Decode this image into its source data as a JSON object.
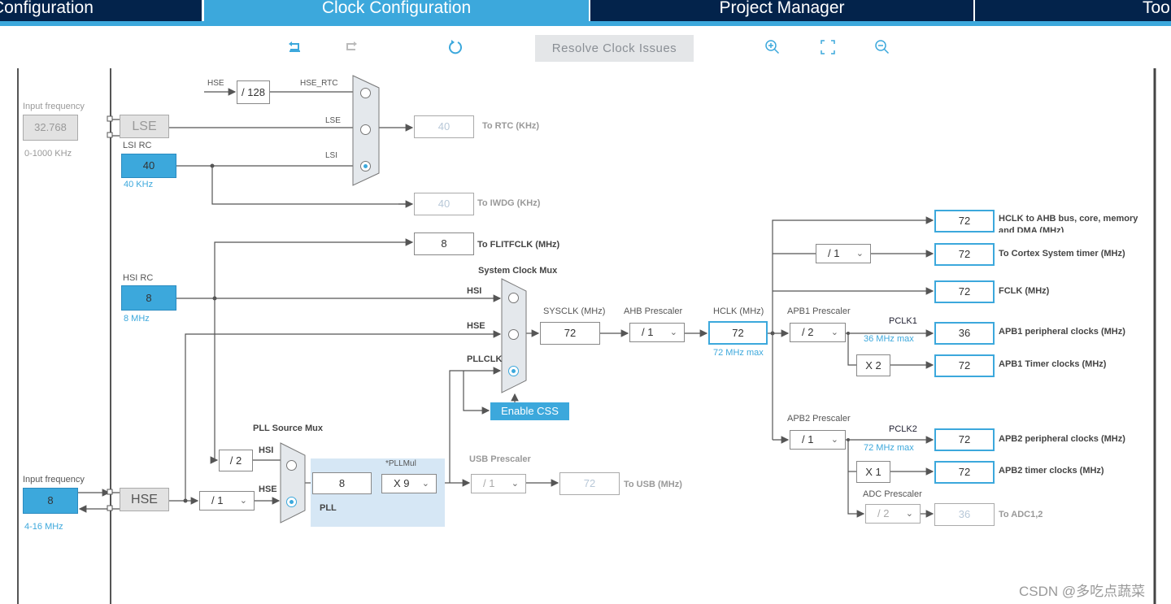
{
  "tabs": [
    {
      "label": "Configuration"
    },
    {
      "label": "Clock Configuration",
      "active": true
    },
    {
      "label": "Project Manager"
    },
    {
      "label": "Too"
    }
  ],
  "toolbar": {
    "undo_icon": "undo-icon",
    "redo_icon": "redo-icon",
    "refresh_icon": "refresh-icon",
    "resolve": "Resolve Clock Issues",
    "zoom_in_icon": "zoom-in-icon",
    "fit_icon": "fit-screen-icon",
    "zoom_out_icon": "zoom-out-icon"
  },
  "lse_in": {
    "label": "Input frequency",
    "value": "32.768",
    "range": "0-1000 KHz",
    "name": "LSE"
  },
  "lsi": {
    "label": "LSI RC",
    "value": "40",
    "unit": "40 KHz"
  },
  "hsi": {
    "label": "HSI RC",
    "value": "8",
    "unit": "8 MHz"
  },
  "hse_in": {
    "label": "Input frequency",
    "value": "8",
    "range": "4-16 MHz",
    "name": "HSE"
  },
  "rtc": {
    "hse": "HSE",
    "div": "/ 128",
    "hse_rtc": "HSE_RTC",
    "lse": "LSE",
    "lsi": "LSI",
    "out": "40",
    "out_label": "To RTC (KHz)"
  },
  "iwdg": {
    "out": "40",
    "label": "To IWDG (KHz)"
  },
  "flit": {
    "out": "8",
    "label": "To FLITFCLK (MHz)"
  },
  "sysmux": {
    "title": "System Clock Mux",
    "hsi": "HSI",
    "hse": "HSE",
    "pllclk": "PLLCLK",
    "css": "Enable CSS"
  },
  "sysclk": {
    "label": "SYSCLK (MHz)",
    "value": "72"
  },
  "ahb": {
    "label": "AHB Prescaler",
    "value": "/ 1"
  },
  "hclk": {
    "label": "HCLK (MHz)",
    "value": "72",
    "max": "72 MHz max"
  },
  "apb1": {
    "label": "APB1 Prescaler",
    "value": "/ 2",
    "pclk": "PCLK1",
    "max": "36 MHz max",
    "mult": "X 2"
  },
  "apb2": {
    "label": "APB2 Prescaler",
    "value": "/ 1",
    "pclk": "PCLK2",
    "max": "72 MHz max",
    "mult": "X 1"
  },
  "adc": {
    "label": "ADC Prescaler",
    "value": "/ 2"
  },
  "cortex_div": "/ 1",
  "outputs": [
    {
      "value": "72",
      "label": "HCLK to AHB bus, core, memory and DMA (MHz)"
    },
    {
      "value": "72",
      "label": "To Cortex System timer (MHz)"
    },
    {
      "value": "72",
      "label": "FCLK (MHz)"
    },
    {
      "value": "36",
      "label": "APB1 peripheral clocks (MHz)"
    },
    {
      "value": "72",
      "label": "APB1 Timer clocks (MHz)"
    },
    {
      "value": "72",
      "label": "APB2 peripheral clocks (MHz)"
    },
    {
      "value": "72",
      "label": "APB2 timer clocks (MHz)"
    },
    {
      "value": "36",
      "label": "To ADC1,2"
    }
  ],
  "pllmux": {
    "title": "PLL Source Mux",
    "div2": "/ 2",
    "hsi": "HSI",
    "hse": "HSE",
    "hse_div": "/ 1"
  },
  "pll": {
    "in": "8",
    "mul_label": "*PLLMul",
    "mul": "X 9",
    "label": "PLL"
  },
  "usb": {
    "label": "USB Prescaler",
    "value": "/ 1",
    "out": "72",
    "out_label": "To USB (MHz)"
  },
  "watermark": "CSDN @多吃点蔬菜",
  "colors": {
    "accent": "#3ca8dc",
    "tab_dark": "#03234b",
    "pll_bg": "#d6e7f5"
  }
}
